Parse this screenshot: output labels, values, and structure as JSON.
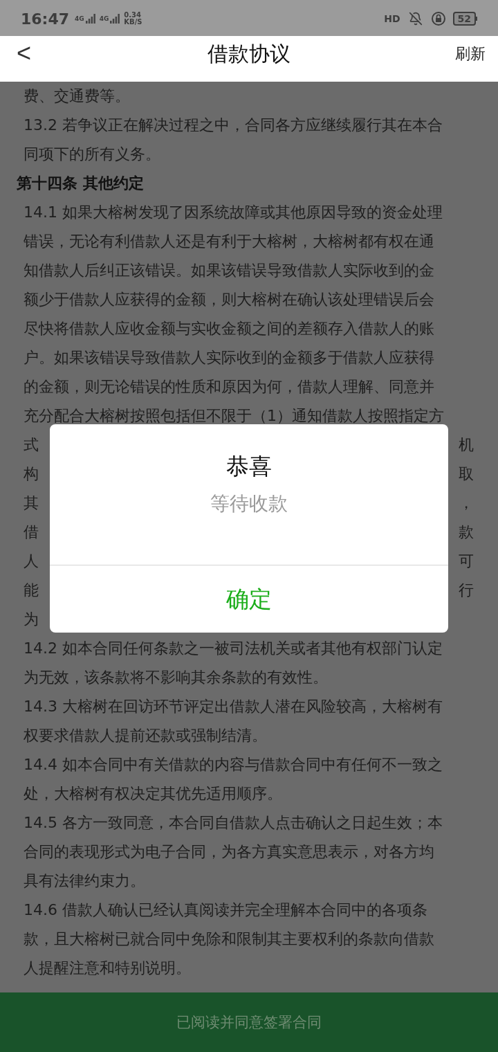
{
  "status_bar": {
    "time": "16:47",
    "sim1": "4G",
    "sim2": "4G",
    "speed": "0.34",
    "speed_unit": "KB/S",
    "hd": "HD",
    "battery": "52"
  },
  "header": {
    "back": "<",
    "title": "借款协议",
    "action": "刷新"
  },
  "content": {
    "lines": [
      {
        "kind": "line",
        "text": "费、交通费等。"
      },
      {
        "kind": "line",
        "text": "13.2 若争议正在解决过程之中，合同各方应继续履行其在本合"
      },
      {
        "kind": "line",
        "text": "同项下的所有义务。"
      },
      {
        "kind": "heading",
        "text": "第十四条 其他约定"
      },
      {
        "kind": "line",
        "text": "14.1 如果大榕树发现了因系统故障或其他原因导致的资金处理"
      },
      {
        "kind": "line",
        "text": "错误，无论有利借款人还是有利于大榕树，大榕树都有权在通"
      },
      {
        "kind": "line",
        "text": "知借款人后纠正该错误。如果该错误导致借款人实际收到的金"
      },
      {
        "kind": "line",
        "text": "额少于借款人应获得的金额，则大榕树在确认该处理错误后会"
      },
      {
        "kind": "line",
        "text": "尽快将借款人应收金额与实收金额之间的差额存入借款人的账"
      },
      {
        "kind": "line",
        "text": "户。如果该错误导致借款人实际收到的金额多于借款人应获得"
      },
      {
        "kind": "line",
        "text": "的金额，则无论错误的性质和原因为何，借款人理解、同意并"
      },
      {
        "kind": "line",
        "text": "充分配合大榕树按照包括但不限于（1）通知借款人按照指定方"
      },
      {
        "kind": "covered",
        "left": "式",
        "right": "机"
      },
      {
        "kind": "covered",
        "left": "构",
        "right": "取"
      },
      {
        "kind": "covered",
        "left": "其",
        "right": "，"
      },
      {
        "kind": "covered",
        "left": "借",
        "right": "款"
      },
      {
        "kind": "covered",
        "left": "人",
        "right": "可"
      },
      {
        "kind": "covered",
        "left": "能",
        "right": "行"
      },
      {
        "kind": "covered",
        "left": "为"
      },
      {
        "kind": "line",
        "text": "14.2 如本合同任何条款之一被司法机关或者其他有权部门认定"
      },
      {
        "kind": "line",
        "text": "为无效，该条款将不影响其余条款的有效性。"
      },
      {
        "kind": "line",
        "text": "14.3 大榕树在回访环节评定出借款人潜在风险较高，大榕树有"
      },
      {
        "kind": "line",
        "text": "权要求借款人提前还款或强制结清。"
      },
      {
        "kind": "line",
        "text": "14.4 如本合同中有关借款的内容与借款合同中有任何不一致之"
      },
      {
        "kind": "line",
        "text": "处，大榕树有权决定其优先适用顺序。"
      },
      {
        "kind": "line",
        "text": "14.5 各方一致同意，本合同自借款人点击确认之日起生效；本"
      },
      {
        "kind": "line",
        "text": "合同的表现形式为电子合同，为各方真实意思表示，对各方均"
      },
      {
        "kind": "line",
        "text": "具有法律约束力。"
      },
      {
        "kind": "line",
        "text": "14.6 借款人确认已经认真阅读并完全理解本合同中的各项条"
      },
      {
        "kind": "line",
        "text": "款，且大榕树已就合同中免除和限制其主要权利的条款向借款"
      },
      {
        "kind": "line",
        "text": "人提醒注意和特别说明。"
      }
    ]
  },
  "sign_button": "已阅读并同意签署合同",
  "dialog": {
    "title": "恭喜",
    "message": "等待收款",
    "confirm": "确定"
  }
}
